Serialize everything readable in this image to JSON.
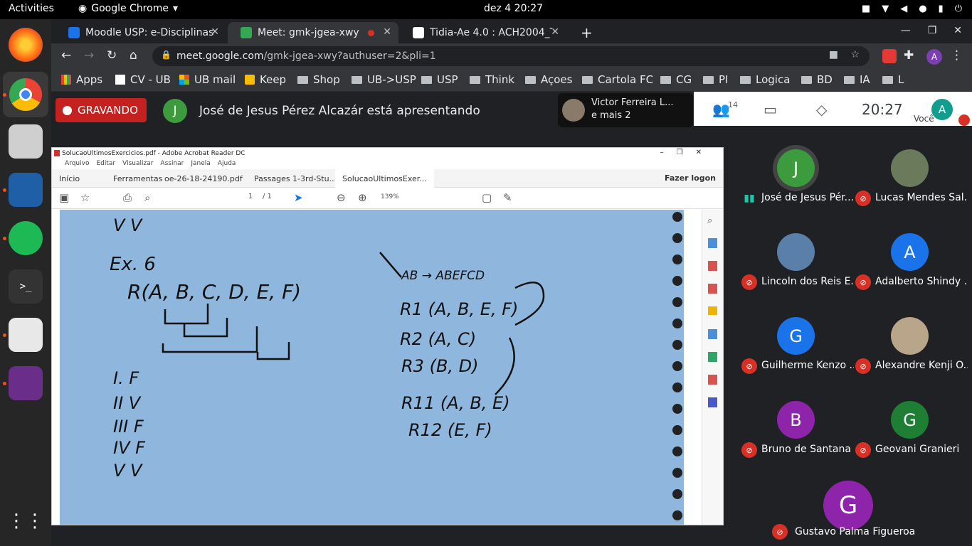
{
  "topbar": {
    "activities": "Activities",
    "app_name": "Google Chrome",
    "clock": "dez 4  20:27"
  },
  "tabs": [
    {
      "title": "Moodle USP: e-Disciplinas",
      "color": "#1a73e8"
    },
    {
      "title": "Meet: gmk-jgea-xwy",
      "color": "#34a853"
    },
    {
      "title": "Tidia-Ae 4.0 : ACH2004_Tu",
      "color": "#ffffff"
    }
  ],
  "omnibox": {
    "host": "meet.google.com",
    "path": "/gmk-jgea-xwy?authuser=2&pli=1"
  },
  "profile_initial": "A",
  "bookmarks": [
    "Apps",
    "CV - UB",
    "UB mail",
    "Keep",
    "Shop",
    "UB->USP",
    "USP",
    "Think",
    "Açoes",
    "Cartola FC",
    "CG",
    "PI",
    "Logica",
    "BD",
    "IA",
    "L"
  ],
  "meet": {
    "recording": "GRAVANDO",
    "presenter_initial": "J",
    "presenting": "José de Jesus Pérez Alcazár está apresentando",
    "others_line1": "Victor Ferreira L...",
    "others_line2": "e mais 2",
    "people_count": "14",
    "time": "20:27",
    "you_label": "Você",
    "you_initial": "A"
  },
  "pdf": {
    "window_title": "SolucaoUltimosExercicios.pdf - Adobe Acrobat Reader DC",
    "menu": [
      "Arquivo",
      "Editar",
      "Visualizar",
      "Assinar",
      "Janela",
      "Ajuda"
    ],
    "tabs": [
      "Início",
      "Ferramentas",
      "oe-26-18-24190.pdf",
      "Passages 1-3rd-Stu...",
      "SolucaoUltimosExer..."
    ],
    "login": "Fazer logon",
    "page": "1",
    "pages": "/ 1",
    "zoom": "139%"
  },
  "notes": {
    "ex": "Ex. 6",
    "relation": "R(A, B, C, D, E, F)",
    "fd": "AB → ABEFCD",
    "r1": "R1 (A, B, E, F)",
    "r2": "R2 (A, C)",
    "r3": "R3 (B, D)",
    "r11": "R11 (A, B, E)",
    "r12": "R12 (E, F)",
    "answers": [
      "I. F",
      "II V",
      "III F",
      "IV F",
      "V V"
    ],
    "top": "V V"
  },
  "participants": [
    {
      "name": "José de Jesus Pér...",
      "initial": "J",
      "color": "#3c9b3c",
      "speaking": true
    },
    {
      "name": "Lucas Mendes Sal...",
      "initial": "",
      "color": "#6b7a5a",
      "speaking": false
    },
    {
      "name": "Lincoln dos Reis E...",
      "initial": "",
      "color": "#5a7fa8",
      "speaking": false
    },
    {
      "name": "Adalberto Shindy ...",
      "initial": "A",
      "color": "#1a73e8",
      "speaking": false
    },
    {
      "name": "Guilherme Kenzo ...",
      "initial": "G",
      "color": "#1a73e8",
      "speaking": false
    },
    {
      "name": "Alexandre Kenji O...",
      "initial": "",
      "color": "#b9a58a",
      "speaking": false
    },
    {
      "name": "Bruno de Santana ...",
      "initial": "B",
      "color": "#8e24aa",
      "speaking": false
    },
    {
      "name": "Geovani Granieri",
      "initial": "G",
      "color": "#1e7e34",
      "speaking": false
    },
    {
      "name": "Gustavo Palma Figueroa",
      "initial": "G",
      "color": "#8e24aa",
      "speaking": false
    }
  ]
}
